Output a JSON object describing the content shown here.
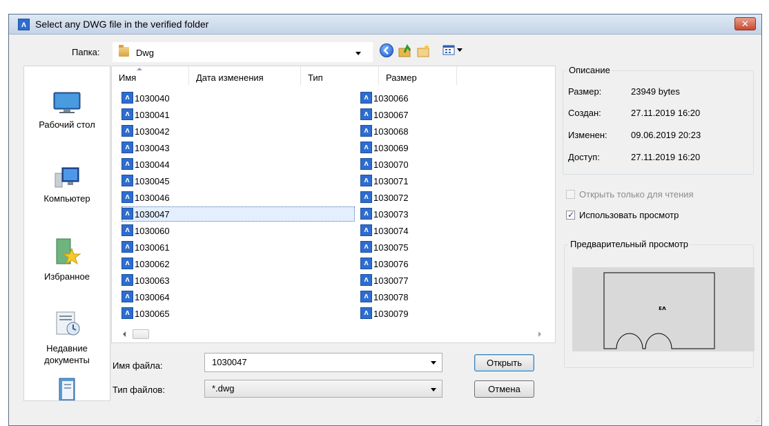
{
  "window": {
    "title": "Select any DWG file in the verified folder",
    "close_glyph": "✕"
  },
  "folder_bar": {
    "label": "Папка:",
    "value": "Dwg",
    "toolbar_icons": [
      "back-icon",
      "up-folder-icon",
      "new-folder-icon",
      "view-menu-icon"
    ]
  },
  "places": [
    {
      "label": "Рабочий стол",
      "icon": "desktop-icon"
    },
    {
      "label": "Компьютер",
      "icon": "computer-icon"
    },
    {
      "label": "Избранное",
      "icon": "favorites-icon"
    },
    {
      "label": "Недавние документы",
      "icon": "recent-documents-icon"
    },
    {
      "label": "",
      "icon": "documents-icon"
    }
  ],
  "file_list": {
    "columns": [
      "Имя",
      "Дата изменения",
      "Тип",
      "Размер"
    ],
    "files": [
      "1030040",
      "1030041",
      "1030042",
      "1030043",
      "1030044",
      "1030045",
      "1030046",
      "1030047",
      "1030060",
      "1030061",
      "1030062",
      "1030063",
      "1030064",
      "1030065",
      "1030066",
      "1030067",
      "1030068",
      "1030069",
      "1030070",
      "1030071",
      "1030072",
      "1030073",
      "1030074",
      "1030075",
      "1030076",
      "1030077",
      "1030078",
      "1030079"
    ],
    "selected": "1030047"
  },
  "filename": {
    "label": "Имя файла:",
    "value": "1030047"
  },
  "filetype": {
    "label": "Тип файлов:",
    "value": "*.dwg"
  },
  "buttons": {
    "open": "Открыть",
    "cancel": "Отмена"
  },
  "description": {
    "title": "Описание",
    "rows": [
      {
        "label": "Размер:",
        "value": "23949 bytes"
      },
      {
        "label": "Создан:",
        "value": "27.11.2019 16:20"
      },
      {
        "label": "Изменен:",
        "value": "09.06.2019 20:23"
      },
      {
        "label": "Доступ:",
        "value": "27.11.2019 16:20"
      }
    ]
  },
  "options": {
    "read_only": {
      "label": "Открыть только для чтения",
      "checked": false,
      "enabled": false
    },
    "use_preview": {
      "label": "Использовать просмотр",
      "checked": true,
      "enabled": true
    }
  },
  "preview": {
    "title": "Предварительный просмотр",
    "stamp": "ᴇᴧ"
  },
  "colors": {
    "accent": "#2e6dd0",
    "selection": "#e3efff",
    "window_bg": "#f0f0f0",
    "preview_bg": "#d9d9d9"
  }
}
